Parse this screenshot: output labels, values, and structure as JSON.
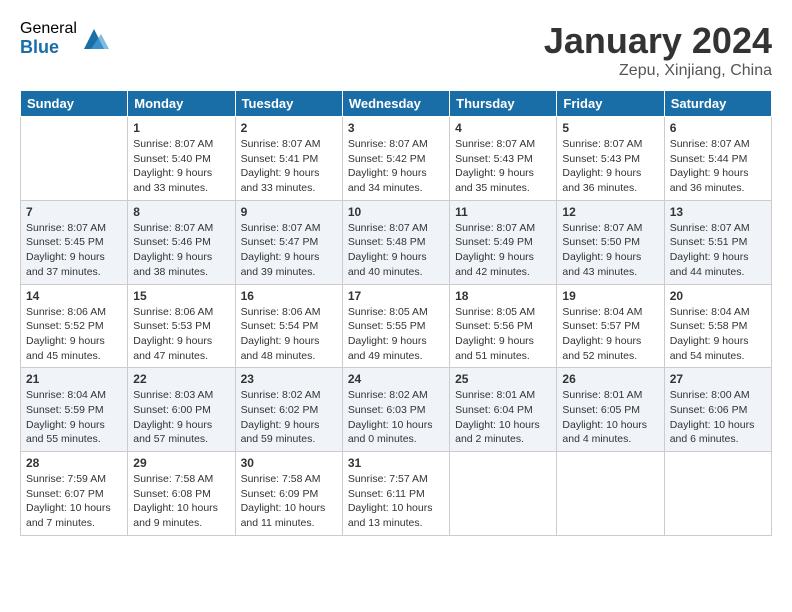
{
  "logo": {
    "general": "General",
    "blue": "Blue"
  },
  "title": "January 2024",
  "location": "Zepu, Xinjiang, China",
  "headers": [
    "Sunday",
    "Monday",
    "Tuesday",
    "Wednesday",
    "Thursday",
    "Friday",
    "Saturday"
  ],
  "weeks": [
    [
      {
        "day": "",
        "info": ""
      },
      {
        "day": "1",
        "info": "Sunrise: 8:07 AM\nSunset: 5:40 PM\nDaylight: 9 hours\nand 33 minutes."
      },
      {
        "day": "2",
        "info": "Sunrise: 8:07 AM\nSunset: 5:41 PM\nDaylight: 9 hours\nand 33 minutes."
      },
      {
        "day": "3",
        "info": "Sunrise: 8:07 AM\nSunset: 5:42 PM\nDaylight: 9 hours\nand 34 minutes."
      },
      {
        "day": "4",
        "info": "Sunrise: 8:07 AM\nSunset: 5:43 PM\nDaylight: 9 hours\nand 35 minutes."
      },
      {
        "day": "5",
        "info": "Sunrise: 8:07 AM\nSunset: 5:43 PM\nDaylight: 9 hours\nand 36 minutes."
      },
      {
        "day": "6",
        "info": "Sunrise: 8:07 AM\nSunset: 5:44 PM\nDaylight: 9 hours\nand 36 minutes."
      }
    ],
    [
      {
        "day": "7",
        "info": "Sunrise: 8:07 AM\nSunset: 5:45 PM\nDaylight: 9 hours\nand 37 minutes."
      },
      {
        "day": "8",
        "info": "Sunrise: 8:07 AM\nSunset: 5:46 PM\nDaylight: 9 hours\nand 38 minutes."
      },
      {
        "day": "9",
        "info": "Sunrise: 8:07 AM\nSunset: 5:47 PM\nDaylight: 9 hours\nand 39 minutes."
      },
      {
        "day": "10",
        "info": "Sunrise: 8:07 AM\nSunset: 5:48 PM\nDaylight: 9 hours\nand 40 minutes."
      },
      {
        "day": "11",
        "info": "Sunrise: 8:07 AM\nSunset: 5:49 PM\nDaylight: 9 hours\nand 42 minutes."
      },
      {
        "day": "12",
        "info": "Sunrise: 8:07 AM\nSunset: 5:50 PM\nDaylight: 9 hours\nand 43 minutes."
      },
      {
        "day": "13",
        "info": "Sunrise: 8:07 AM\nSunset: 5:51 PM\nDaylight: 9 hours\nand 44 minutes."
      }
    ],
    [
      {
        "day": "14",
        "info": "Sunrise: 8:06 AM\nSunset: 5:52 PM\nDaylight: 9 hours\nand 45 minutes."
      },
      {
        "day": "15",
        "info": "Sunrise: 8:06 AM\nSunset: 5:53 PM\nDaylight: 9 hours\nand 47 minutes."
      },
      {
        "day": "16",
        "info": "Sunrise: 8:06 AM\nSunset: 5:54 PM\nDaylight: 9 hours\nand 48 minutes."
      },
      {
        "day": "17",
        "info": "Sunrise: 8:05 AM\nSunset: 5:55 PM\nDaylight: 9 hours\nand 49 minutes."
      },
      {
        "day": "18",
        "info": "Sunrise: 8:05 AM\nSunset: 5:56 PM\nDaylight: 9 hours\nand 51 minutes."
      },
      {
        "day": "19",
        "info": "Sunrise: 8:04 AM\nSunset: 5:57 PM\nDaylight: 9 hours\nand 52 minutes."
      },
      {
        "day": "20",
        "info": "Sunrise: 8:04 AM\nSunset: 5:58 PM\nDaylight: 9 hours\nand 54 minutes."
      }
    ],
    [
      {
        "day": "21",
        "info": "Sunrise: 8:04 AM\nSunset: 5:59 PM\nDaylight: 9 hours\nand 55 minutes."
      },
      {
        "day": "22",
        "info": "Sunrise: 8:03 AM\nSunset: 6:00 PM\nDaylight: 9 hours\nand 57 minutes."
      },
      {
        "day": "23",
        "info": "Sunrise: 8:02 AM\nSunset: 6:02 PM\nDaylight: 9 hours\nand 59 minutes."
      },
      {
        "day": "24",
        "info": "Sunrise: 8:02 AM\nSunset: 6:03 PM\nDaylight: 10 hours\nand 0 minutes."
      },
      {
        "day": "25",
        "info": "Sunrise: 8:01 AM\nSunset: 6:04 PM\nDaylight: 10 hours\nand 2 minutes."
      },
      {
        "day": "26",
        "info": "Sunrise: 8:01 AM\nSunset: 6:05 PM\nDaylight: 10 hours\nand 4 minutes."
      },
      {
        "day": "27",
        "info": "Sunrise: 8:00 AM\nSunset: 6:06 PM\nDaylight: 10 hours\nand 6 minutes."
      }
    ],
    [
      {
        "day": "28",
        "info": "Sunrise: 7:59 AM\nSunset: 6:07 PM\nDaylight: 10 hours\nand 7 minutes."
      },
      {
        "day": "29",
        "info": "Sunrise: 7:58 AM\nSunset: 6:08 PM\nDaylight: 10 hours\nand 9 minutes."
      },
      {
        "day": "30",
        "info": "Sunrise: 7:58 AM\nSunset: 6:09 PM\nDaylight: 10 hours\nand 11 minutes."
      },
      {
        "day": "31",
        "info": "Sunrise: 7:57 AM\nSunset: 6:11 PM\nDaylight: 10 hours\nand 13 minutes."
      },
      {
        "day": "",
        "info": ""
      },
      {
        "day": "",
        "info": ""
      },
      {
        "day": "",
        "info": ""
      }
    ]
  ]
}
